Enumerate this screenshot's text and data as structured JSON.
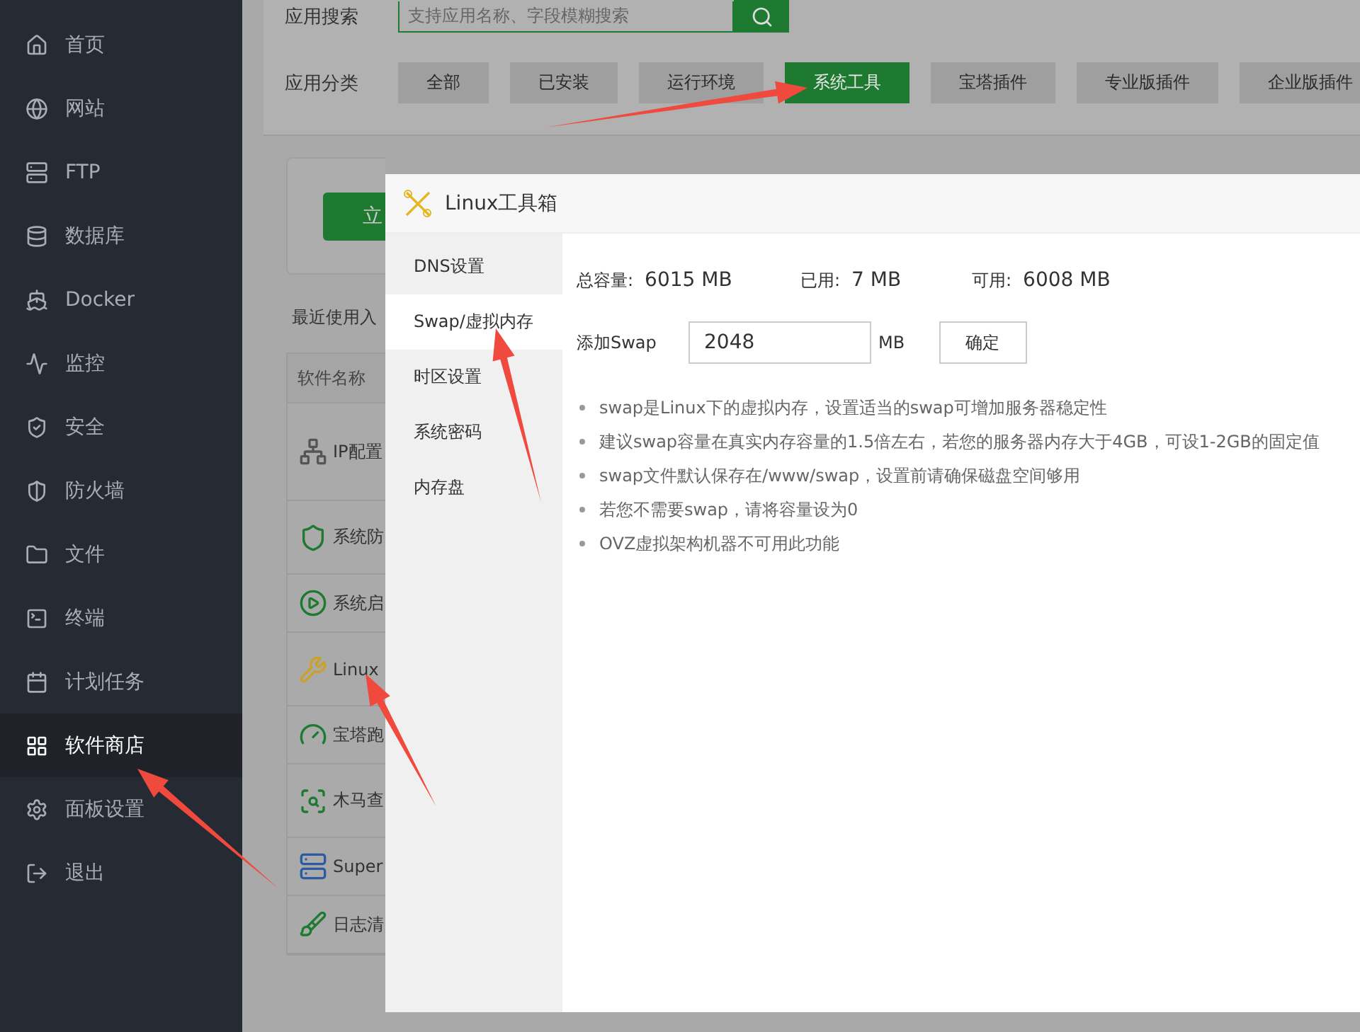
{
  "sidebar": {
    "items": [
      {
        "label": "首页",
        "selected": false
      },
      {
        "label": "网站",
        "selected": false
      },
      {
        "label": "FTP",
        "selected": false
      },
      {
        "label": "数据库",
        "selected": false
      },
      {
        "label": "Docker",
        "selected": false
      },
      {
        "label": "监控",
        "selected": false
      },
      {
        "label": "安全",
        "selected": false
      },
      {
        "label": "防火墙",
        "selected": false
      },
      {
        "label": "文件",
        "selected": false
      },
      {
        "label": "终端",
        "selected": false
      },
      {
        "label": "计划任务",
        "selected": false
      },
      {
        "label": "软件商店",
        "selected": true
      },
      {
        "label": "面板设置",
        "selected": false
      },
      {
        "label": "退出",
        "selected": false
      }
    ]
  },
  "search": {
    "label": "应用搜索",
    "placeholder": "支持应用名称、字段模糊搜索"
  },
  "categories": {
    "label": "应用分类",
    "items": [
      {
        "label": "全部",
        "selected": false
      },
      {
        "label": "已安装",
        "selected": false
      },
      {
        "label": "运行环境",
        "selected": false
      },
      {
        "label": "系统工具",
        "selected": true
      },
      {
        "label": "宝塔插件",
        "selected": false
      },
      {
        "label": "专业版插件",
        "selected": false
      },
      {
        "label": "企业版插件",
        "selected": false
      }
    ]
  },
  "promo": {
    "button": "立"
  },
  "recent": {
    "label": "最近使用入"
  },
  "table": {
    "column": "软件名称",
    "rows": [
      "IP配置",
      "系统防",
      "系统启",
      "Linux",
      "宝塔跑",
      "木马查",
      "Super",
      "日志清"
    ]
  },
  "modal": {
    "title": "Linux工具箱",
    "tabs": [
      {
        "label": "DNS设置",
        "selected": false
      },
      {
        "label": "Swap/虚拟内存",
        "selected": true
      },
      {
        "label": "时区设置",
        "selected": false
      },
      {
        "label": "系统密码",
        "selected": false
      },
      {
        "label": "内存盘",
        "selected": false
      }
    ],
    "stats": [
      {
        "label": "总容量:",
        "value": "6015 MB"
      },
      {
        "label": "已用:",
        "value": "7 MB"
      },
      {
        "label": "可用:",
        "value": "6008 MB"
      }
    ],
    "swap": {
      "label": "添加Swap",
      "value": "2048",
      "unit": "MB",
      "button": "确定"
    },
    "notes": [
      "swap是Linux下的虚拟内存，设置适当的swap可增加服务器稳定性",
      "建议swap容量在真实内存容量的1.5倍左右，若您的服务器内存大于4GB，可设1-2GB的固定值",
      "swap文件默认保存在/www/swap，设置前请确保磁盘空间够用",
      "若您不需要swap，请将容量设为0",
      "OVZ虚拟架构机器不可用此功能"
    ]
  }
}
